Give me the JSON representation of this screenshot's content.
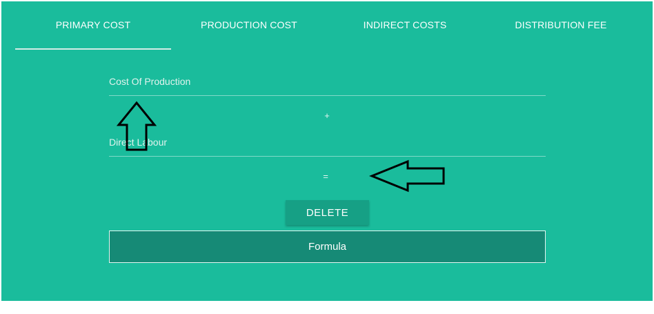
{
  "tabs": [
    {
      "label": "PRIMARY COST",
      "active": true
    },
    {
      "label": "PRODUCTION COST",
      "active": false
    },
    {
      "label": "INDIRECT COSTS",
      "active": false
    },
    {
      "label": "DISTRIBUTION FEE",
      "active": false
    }
  ],
  "form": {
    "field_1": {
      "placeholder": "Cost Of Production",
      "value": ""
    },
    "operator_1": "+",
    "field_2": {
      "placeholder": "Direct Labour",
      "value": ""
    },
    "operator_2": "="
  },
  "actions": {
    "delete_label": "DELETE",
    "formula_label": "Formula"
  },
  "colors": {
    "background": "#1abc9c",
    "button": "#16a085",
    "formula_button": "#168a76"
  },
  "annotations": [
    "arrow-up-icon",
    "arrow-left-icon"
  ]
}
